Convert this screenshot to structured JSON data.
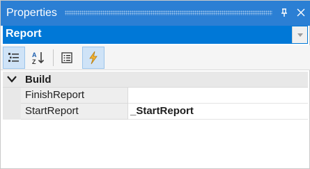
{
  "window": {
    "title": "Properties",
    "pin_icon": "pin-icon",
    "close_icon": "close-icon"
  },
  "object_selector": {
    "value": "Report",
    "dropdown_icon": "chevron-down-icon"
  },
  "toolbar": {
    "buttons": [
      {
        "icon": "categorized-icon",
        "active": true
      },
      {
        "icon": "sort-alphabetical-icon",
        "active": false
      },
      {
        "icon": "properties-icon",
        "active": false
      },
      {
        "icon": "events-lightning-icon",
        "active": true
      }
    ]
  },
  "grid": {
    "category": {
      "label": "Build",
      "expanded": true
    },
    "rows": [
      {
        "name": "FinishReport",
        "value": ""
      },
      {
        "name": "StartReport",
        "value": "_StartReport"
      }
    ]
  },
  "colors": {
    "title_bar": "#2b7fd4",
    "selection": "#0078d7",
    "active_button": "#cfe3f7"
  }
}
